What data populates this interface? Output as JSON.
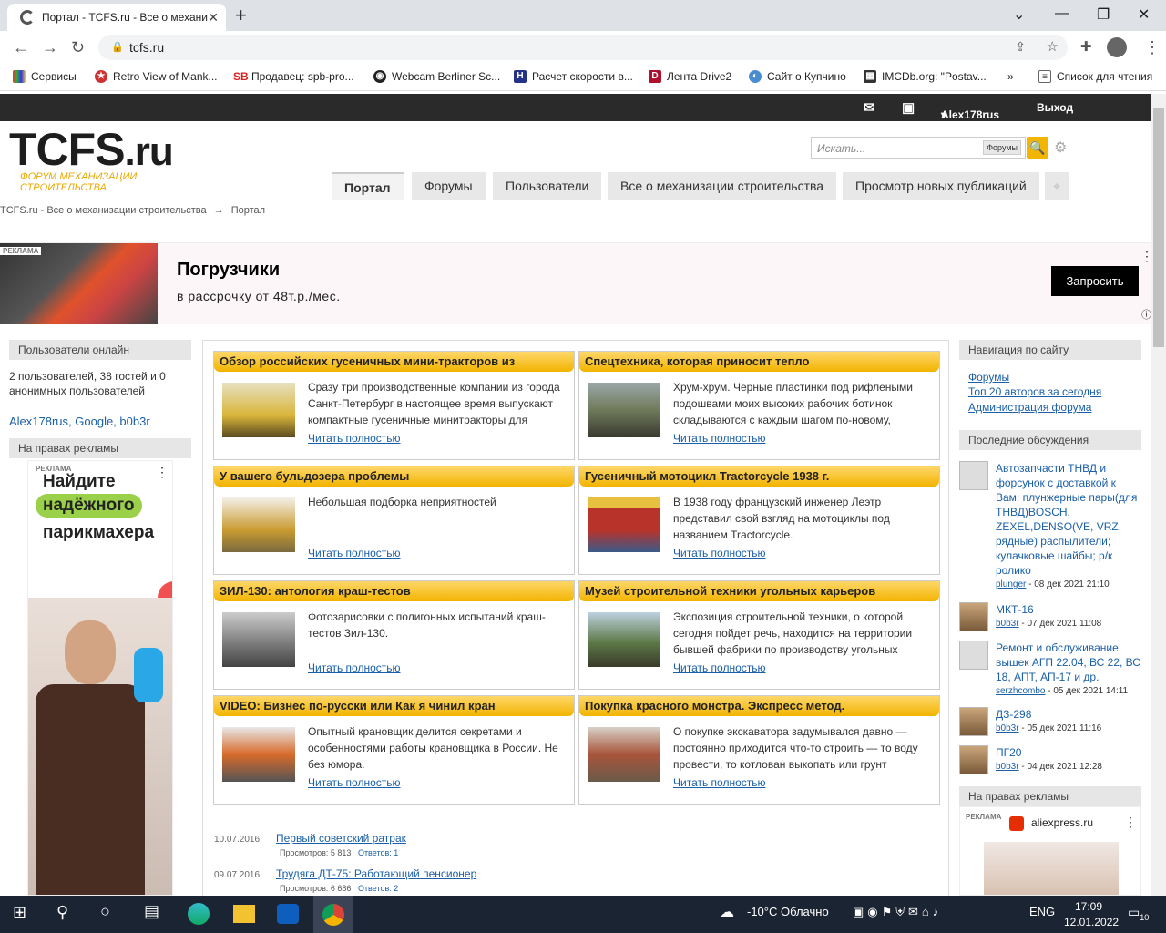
{
  "browser": {
    "tab_title": "Портал - TCFS.ru - Все о механи",
    "url": "tcfs.ru",
    "bookmarks": [
      "Сервисы",
      "Retro View of Mank...",
      "Продавец: spb-pro...",
      "Webcam Berliner Sc...",
      "Расчет скорости в...",
      "Лента Drive2",
      "Сайт о Купчино",
      "IMCDb.org: \"Postav...",
      "Список для чтения"
    ],
    "more": "»"
  },
  "topbar": {
    "user": "Alex178rus",
    "logout": "Выход"
  },
  "site": {
    "logo": "TCFS",
    "logo_suffix": ".ru",
    "tagline": "ФОРУМ МЕХАНИЗАЦИИ СТРОИТЕЛЬСТВА",
    "search_placeholder": "Искать...",
    "search_scope": "Форумы",
    "nav": [
      "Портал",
      "Форумы",
      "Пользователи",
      "Все о механизации строительства",
      "Просмотр новых публикаций"
    ],
    "breadcrumb_root": "TCFS.ru - Все о механизации строительства",
    "breadcrumb_arrow": "→",
    "breadcrumb_current": "Портал"
  },
  "ad": {
    "tag": "РЕКЛАМА",
    "title": "Погрузчики",
    "subtitle": "в рассрочку от 48т.р./мес.",
    "button": "Запросить"
  },
  "left": {
    "online_head": "Пользователи онлайн",
    "online_text": "2 пользователей, 38 гостей и 0 анонимных пользователей",
    "online_users": "Alex178rus, Google, b0b3r",
    "ad_head": "На правах рекламы",
    "ad_tag": "РЕКЛАМА",
    "ad_l1": "Найдите",
    "ad_l2": "надёжного",
    "ad_l3": "парикмахера"
  },
  "articles": [
    {
      "title": "Обзор российских гусеничных мини-тракторов из",
      "text": "Сразу три производственные компании из города Санкт-Петербург в настоящее время выпускают компактные гусеничные минитракторы для",
      "more": "Читать полностью",
      "thumb": "#d9b53a"
    },
    {
      "title": "Спецтехника, которая приносит тепло",
      "text": "Хрум-хрум. Черные пластинки под рифлеными подошвами моих высоких рабочих ботинок складываются с каждым шагом по-новому,",
      "more": "Читать полностью",
      "thumb": "#6f7a5a"
    },
    {
      "title": "У вашего бульдозера проблемы",
      "text": "Небольшая подборка неприятностей",
      "more": "Читать полностью",
      "thumb": "#c99a30"
    },
    {
      "title": "Гусеничный мотоцикл Tractorcycle 1938 г.",
      "text": "В 1938 году французский инженер Леэтр представил свой взгляд на мотоциклы под названием Tractorcycle.",
      "more": "Читать полностью",
      "thumb": "#b8332a"
    },
    {
      "title": "ЗИЛ-130: антология краш-тестов",
      "text": "Фотозарисовки с полигонных испытаний краш-тестов Зил-130.",
      "more": "Читать полностью",
      "thumb": "#777777"
    },
    {
      "title": "Музей строительной техники угольных карьеров",
      "text": "Экспозиция строительной техники, о которой сегодня пойдет речь, находится на территории бывшей фабрики по производству угольных",
      "more": "Читать полностью",
      "thumb": "#5d7a48"
    },
    {
      "title": "VIDEO: Бизнес по-русски или Как я чинил кран",
      "text": "Опытный крановщик делится секретами и особенностями работы крановщика в России. Не без юмора.",
      "more": "Читать полностью",
      "thumb": "#d86a2a"
    },
    {
      "title": "Покупка красного монстра. Экспресс метод.",
      "text": "О покупке экскаватора задумывался давно — постоянно приходится что-то строить — то воду провести, то котлован выкопать или грунт лишний",
      "more": "Читать полностью",
      "thumb": "#a8553a"
    }
  ],
  "news": [
    {
      "date": "10.07.2016",
      "title": "Первый советский ратрак",
      "views": "Просмотров: 5 813",
      "replies": "Ответов: 1"
    },
    {
      "date": "09.07.2016",
      "title": "Трудяга ДТ-75: Работающий пенсионер",
      "views": "Просмотров: 6 686",
      "replies": "Ответов: 2"
    }
  ],
  "right": {
    "nav_head": "Навигация по сайту",
    "nav_links": [
      "Форумы",
      "Топ 20 авторов за сегодня",
      "Администрация форума"
    ],
    "disc_head": "Последние обсуждения",
    "discussions": [
      {
        "title": "Автозапчасти ТНВД и форсунок с доставкой к Вам: плунжерные пары(для ТНВД)BOSCH, ZEXEL,DENSO(VE, VRZ, рядные) распылители; кулачковые шайбы; р/к ролико",
        "user": "plunger",
        "date": " - 08 дек 2021 21:10"
      },
      {
        "title": "МКТ-16",
        "user": "b0b3r",
        "date": " - 07 дек 2021 11:08"
      },
      {
        "title": "Ремонт и обслуживание вышек АГП 22.04, ВС 22, ВС 18, АПТ, АП-17 и др.",
        "user": "serzhcombo",
        "date": " - 05 дек 2021 14:11"
      },
      {
        "title": "ДЗ-298",
        "user": "b0b3r",
        "date": " - 05 дек 2021 11:16"
      },
      {
        "title": "ПГ20",
        "user": "b0b3r",
        "date": " - 04 дек 2021 12:28"
      }
    ],
    "ad_head": "На правах рекламы",
    "ad_tag": "РЕКЛАМА",
    "ad_site": "aliexpress.ru"
  },
  "taskbar": {
    "weather": "-10°C Облачно",
    "lang": "ENG",
    "time": "17:09",
    "date": "12.01.2022",
    "notif": "10"
  }
}
